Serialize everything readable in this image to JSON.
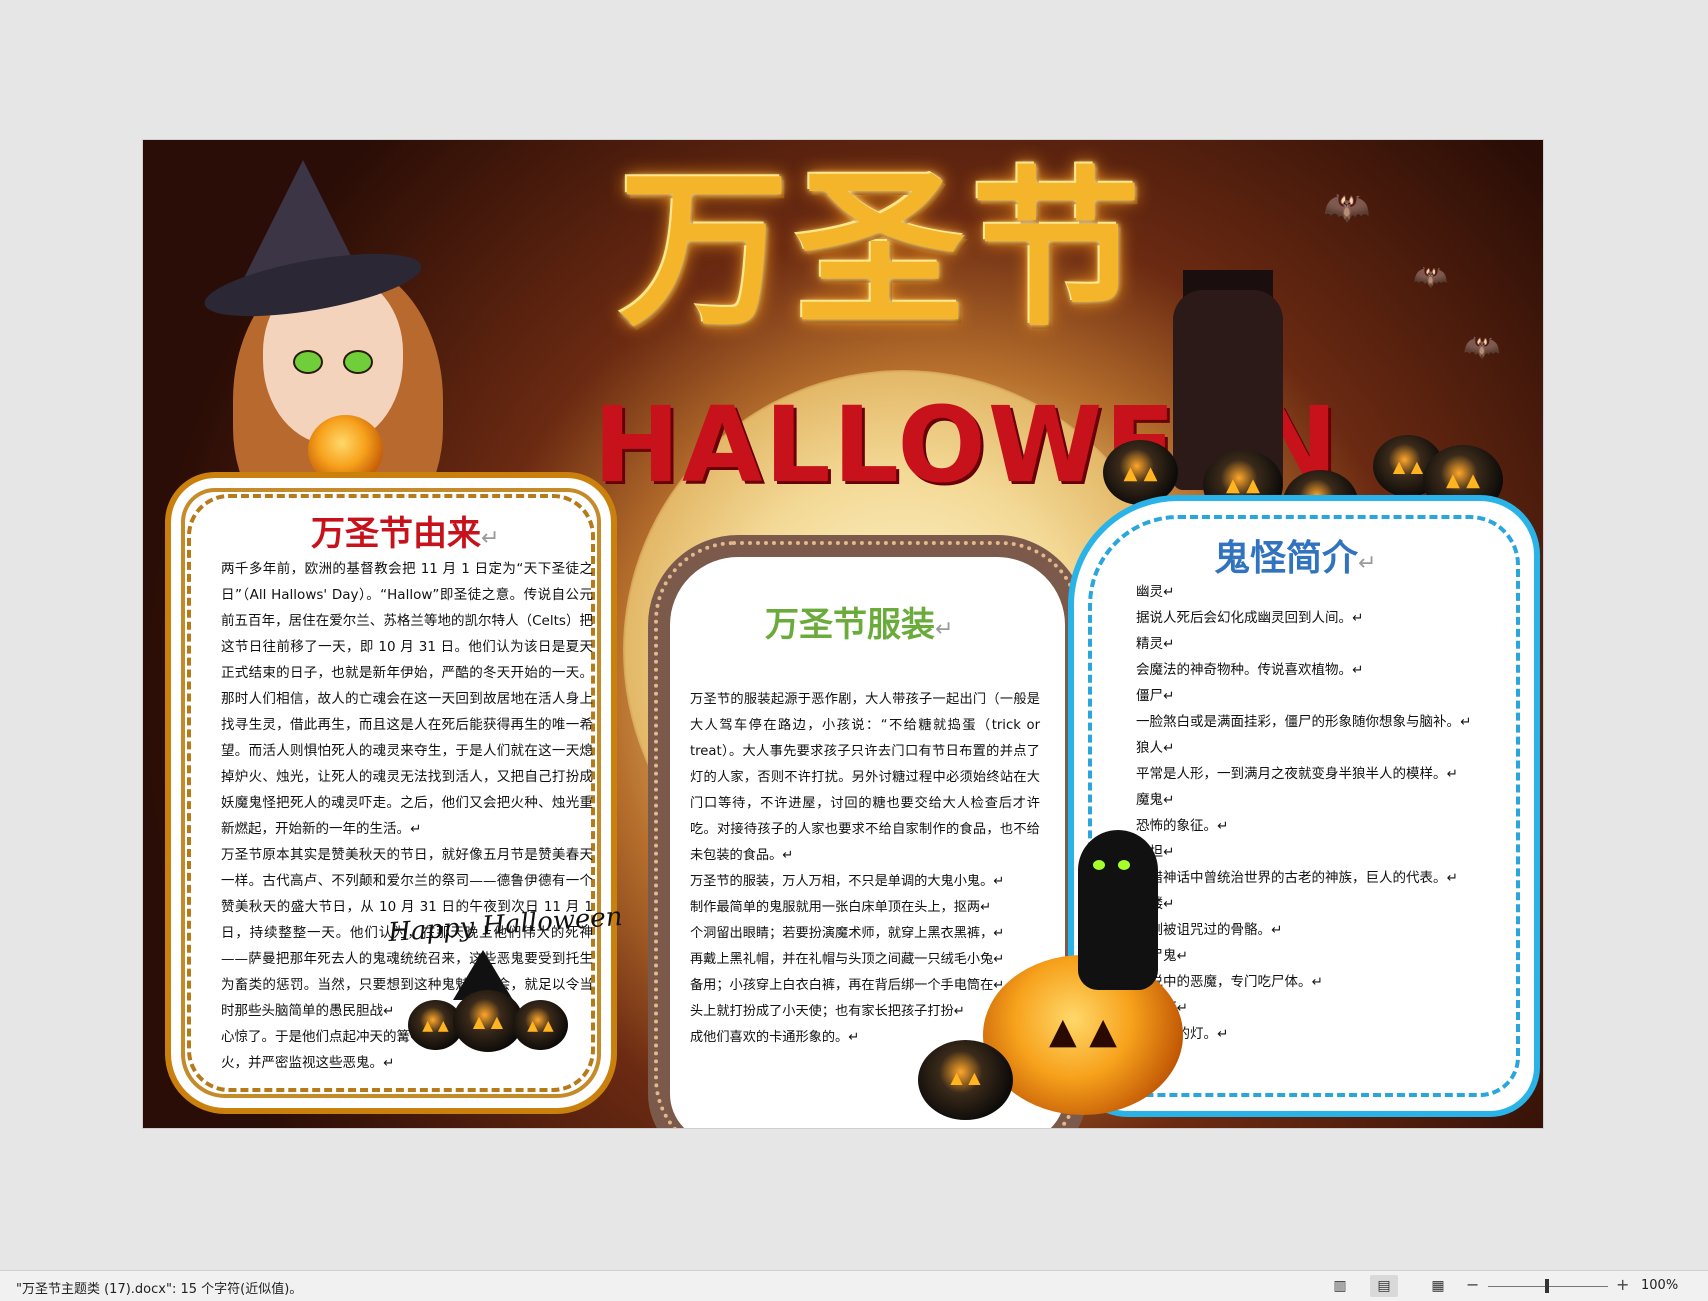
{
  "poster": {
    "title_cn": "万圣节",
    "title_en": "HALLOWEEN",
    "paragraph_mark": "↵",
    "happy_halloween": "Happy Halloween",
    "left_panel": {
      "heading": "万圣节由来",
      "paragraphs": [
        "两千多年前，欧洲的基督教会把 11 月 1 日定为“天下圣徒之日”（All Hallows' Day）。“Hallow”即圣徒之意。传说自公元前五百年，居住在爱尔兰、苏格兰等地的凯尔特人（Celts）把这节日往前移了一天，即 10 月 31 日。他们认为该日是夏天正式结束的日子，也就是新年伊始，严酷的冬天开始的一天。那时人们相信，故人的亡魂会在这一天回到故居地在活人身上找寻生灵，借此再生，而且这是人在死后能获得再生的唯一希望。而活人则惧怕死人的魂灵来夺生，于是人们就在这一天熄掉炉火、烛光，让死人的魂灵无法找到活人，又把自己打扮成妖魔鬼怪把死人的魂灵吓走。之后，他们又会把火种、烛光重新燃起，开始新的一年的生活。↵",
        "万圣节原本其实是赞美秋天的节日，就好像五月节是赞美春天一样。古代高卢、不列颠和爱尔兰的祭司——德鲁伊德有一个赞美秋天的盛大节日，从 10 月 31 日的午夜到次日 11 月 1 日，持续整整一天。他们认为，在那天晚上他们伟大的死神——萨曼把那年死去人的鬼魂统统召来，这些恶鬼要受到托生为畜类的惩罚。当然，只要想到这种鬼魅的聚会，就足以令当时那些头脑简单的愚民胆战↵",
        "心惊了。于是他们点起冲天的篝↵",
        "火，并严密监视这些恶鬼。↵"
      ]
    },
    "middle_panel": {
      "heading": "万圣节服装",
      "paragraphs": [
        "万圣节的服装起源于恶作剧，大人带孩子一起出门（一般是大人驾车停在路边，小孩说：“不给糖就捣蛋（trick or treat）。大人事先要求孩子只许去门口有节日布置的并点了灯的人家，否则不许打扰。另外讨糖过程中必须始终站在大门口等待，不许进屋，讨回的糖也要交给大人检查后才许吃。对接待孩子的人家也要求不给自家制作的食品，也不给未包装的食品。↵",
        "万圣节的服装，万人万相，不只是单调的大鬼小鬼。↵",
        "制作最简单的鬼服就用一张白床单顶在头上，抠两↵",
        "个洞留出眼睛；若要扮演魔术师，就穿上黑衣黑裤，↵",
        "再戴上黑礼帽，并在礼帽与头顶之间藏一只绒毛小兔↵",
        "备用；小孩穿上白衣白裤，再在背后绑一个手电筒在↵",
        "头上就打扮成了小天使；也有家长把孩子打扮↵",
        "成他们喜欢的卡通形象的。↵"
      ]
    },
    "right_panel": {
      "heading": "鬼怪简介",
      "lines": [
        "幽灵↵",
        "据说人死后会幻化成幽灵回到人间。↵",
        "精灵↵",
        "会魔法的神奇物种。传说喜欢植物。↵",
        "僵尸↵",
        "一脸煞白或是满面挂彩，僵尸的形象随你想象与脑补。↵",
        "狼人↵",
        "平常是人形，一到满月之夜就变身半狼半人的模样。↵",
        "魔鬼↵",
        "恐怖的象征。↵",
        "泰坦↵",
        "希腊神话中曾统治世界的古老的神族，巨人的代表。↵",
        "骷髅↵",
        "一副被诅咒过的骨骼。↵",
        "食尸鬼↵",
        "传说中的恶魔，专门吃尸体。↵",
        "南瓜灯↵",
        "像南瓜的灯。↵"
      ]
    }
  },
  "statusbar": {
    "document_status": "\"万圣节主题类 (17).docx\": 15 个字符(近似值)。",
    "view_icons": [
      "read-mode-icon",
      "print-layout-icon",
      "web-layout-icon"
    ],
    "zoom_minus": "−",
    "zoom_plus": "+",
    "zoom_value": "100%",
    "zoom_level": 1.0
  }
}
